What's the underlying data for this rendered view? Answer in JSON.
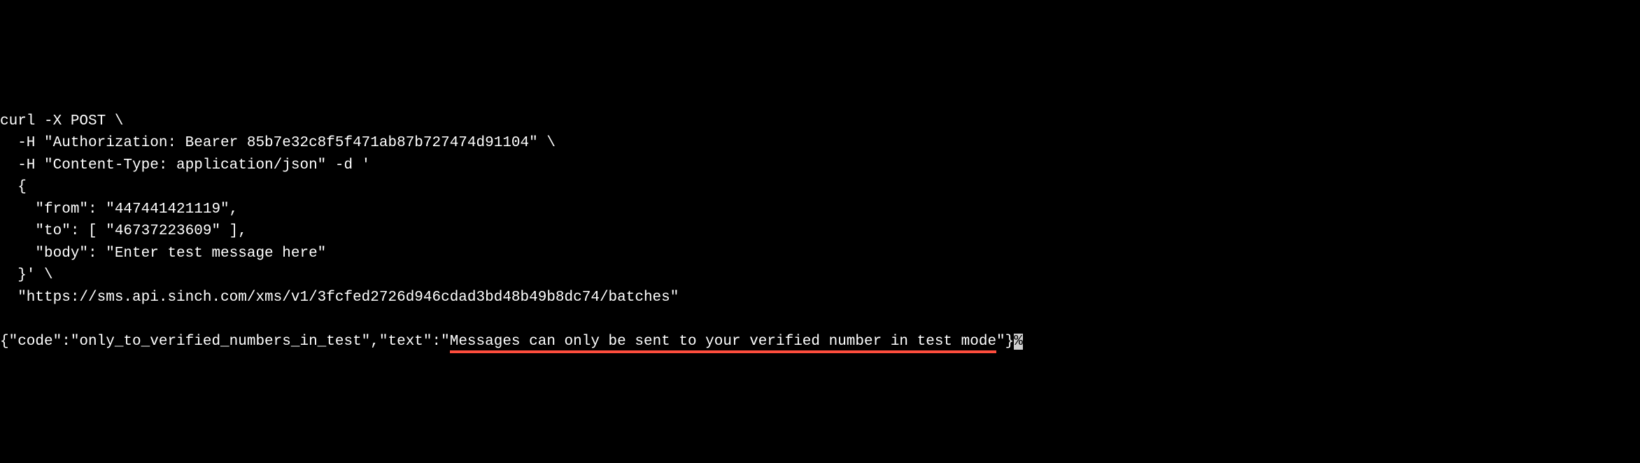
{
  "terminal": {
    "lines": {
      "l1": "curl -X POST \\",
      "l2": "  -H \"Authorization: Bearer 85b7e32c8f5f471ab87b727474d91104\" \\",
      "l3": "  -H \"Content-Type: application/json\" -d '",
      "l4": "  {",
      "l5": "    \"from\": \"447441421119\",",
      "l6": "    \"to\": [ \"46737223609\" ],",
      "l7": "    \"body\": \"Enter test message here\"",
      "l8": "  }' \\",
      "l9": "  \"https://sms.api.sinch.com/xms/v1/3fcfed2726d946cdad3bd48b49b8dc74/batches\"",
      "blank": "",
      "response_prefix": "{\"code\":\"only_to_verified_numbers_in_test\",\"text\":\"",
      "response_underlined": "Messages can only be sent to your verified number in test mode",
      "response_suffix": "\"}",
      "cursor": "%"
    }
  }
}
